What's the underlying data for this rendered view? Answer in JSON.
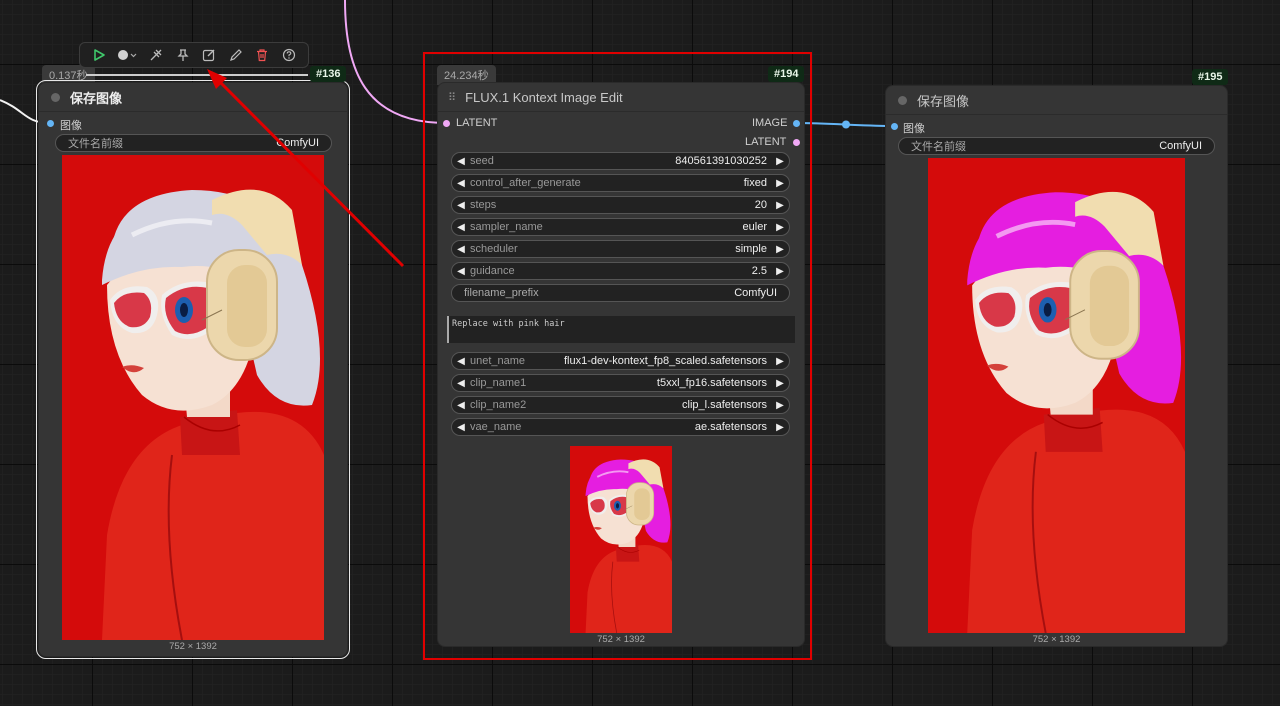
{
  "toolbar": {
    "items": [
      "run-icon",
      "color-icon",
      "bypass-icon",
      "pin-icon",
      "edit-icon",
      "pencil-icon",
      "delete-icon",
      "help-icon"
    ]
  },
  "node136": {
    "time": "0.137秒",
    "id": "#136",
    "title": "保存图像",
    "input_label": "图像",
    "prefix_label": "文件名前缀",
    "prefix_value": "ComfyUI",
    "dims": "752 × 1392",
    "hair_color": "#d4d5e2"
  },
  "node194": {
    "time": "24.234秒",
    "id": "#194",
    "title": "FLUX.1 Kontext Image Edit",
    "input_label": "LATENT",
    "output_image": "IMAGE",
    "output_latent": "LATENT",
    "widgets": [
      {
        "label": "seed",
        "value": "840561391030252"
      },
      {
        "label": "control_after_generate",
        "value": "fixed"
      },
      {
        "label": "steps",
        "value": "20"
      },
      {
        "label": "sampler_name",
        "value": "euler"
      },
      {
        "label": "scheduler",
        "value": "simple"
      },
      {
        "label": "guidance",
        "value": "2.5"
      }
    ],
    "filename_prefix_label": "filename_prefix",
    "filename_prefix_value": "ComfyUI",
    "prompt": "Replace with pink hair",
    "models": [
      {
        "label": "unet_name",
        "value": "flux1-dev-kontext_fp8_scaled.safetensors"
      },
      {
        "label": "clip_name1",
        "value": "t5xxl_fp16.safetensors"
      },
      {
        "label": "clip_name2",
        "value": "clip_l.safetensors"
      },
      {
        "label": "vae_name",
        "value": "ae.safetensors"
      }
    ],
    "dims": "752 × 1392",
    "hair_color": "#e51ee0"
  },
  "node195": {
    "id": "#195",
    "title": "保存图像",
    "input_label": "图像",
    "prefix_label": "文件名前缀",
    "prefix_value": "ComfyUI",
    "dims": "752 × 1392",
    "hair_color": "#e51ee0"
  }
}
